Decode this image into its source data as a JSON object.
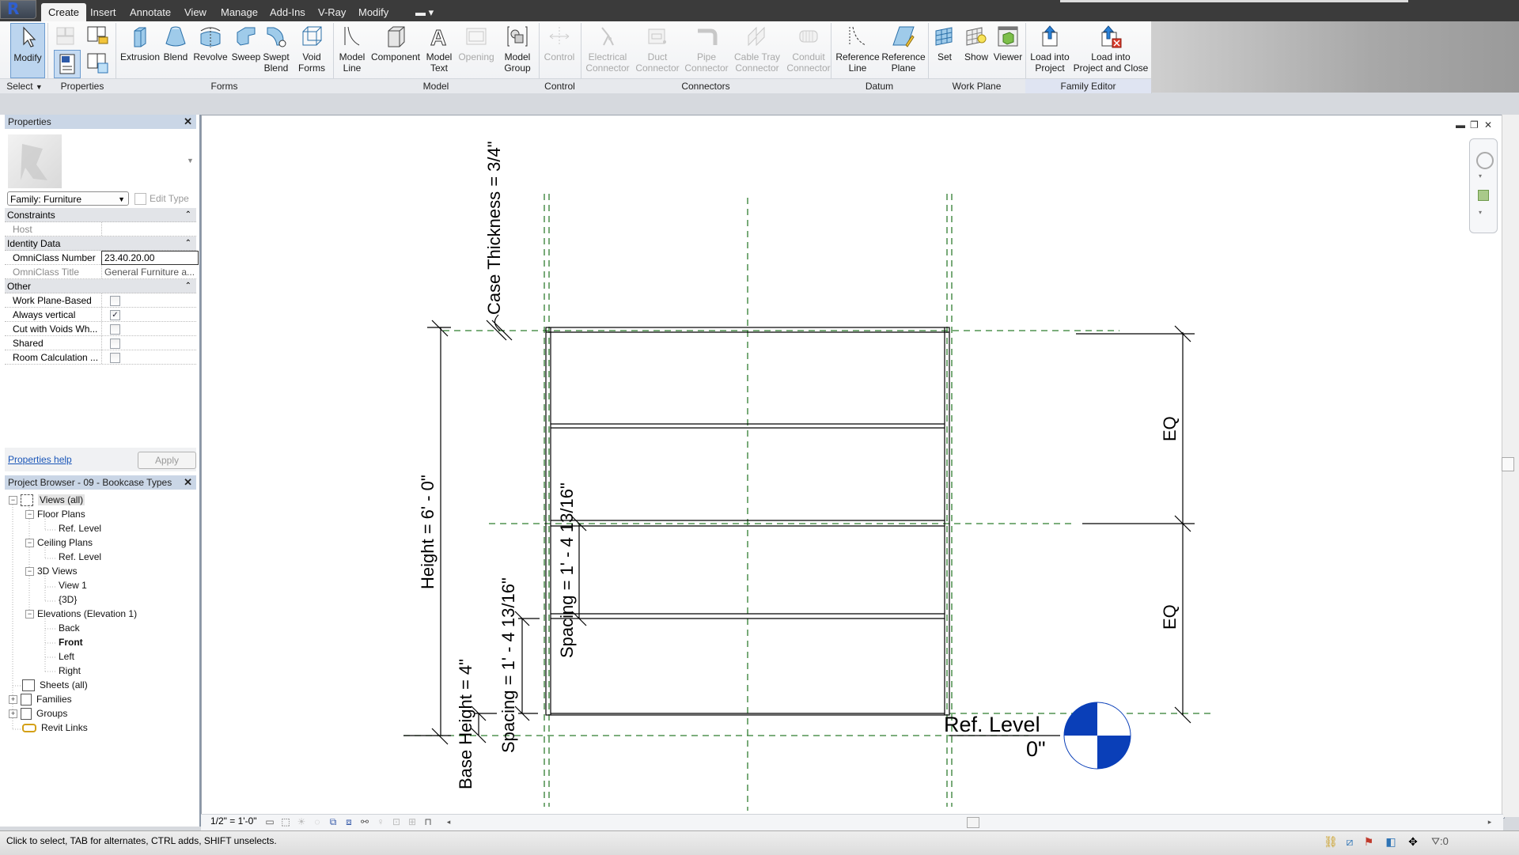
{
  "ribbon": {
    "tabs": [
      "Create",
      "Insert",
      "Annotate",
      "View",
      "Manage",
      "Add-Ins",
      "V-Ray",
      "Modify"
    ],
    "active_tab": "Create",
    "groups": {
      "select": "Select",
      "properties": "Properties",
      "forms": "Forms",
      "model": "Model",
      "control": "Control",
      "connectors": "Connectors",
      "datum": "Datum",
      "work_plane": "Work Plane",
      "family_editor": "Family Editor"
    },
    "buttons": {
      "modify": "Modify",
      "extrusion": "Extrusion",
      "blend": "Blend",
      "revolve": "Revolve",
      "sweep": "Sweep",
      "swept_blend": [
        "Swept",
        "Blend"
      ],
      "void_forms": [
        "Void",
        "Forms"
      ],
      "model_line": [
        "Model",
        "Line"
      ],
      "component": "Component",
      "model_text": [
        "Model",
        "Text"
      ],
      "opening": "Opening",
      "model_group": [
        "Model",
        "Group"
      ],
      "control": "Control",
      "electrical_connector": [
        "Electrical",
        "Connector"
      ],
      "duct_connector": [
        "Duct",
        "Connector"
      ],
      "pipe_connector": [
        "Pipe",
        "Connector"
      ],
      "cable_tray_connector": [
        "Cable Tray",
        "Connector"
      ],
      "conduit_connector": [
        "Conduit",
        "Connector"
      ],
      "reference_line": [
        "Reference",
        "Line"
      ],
      "reference_plane": [
        "Reference",
        "Plane"
      ],
      "set": "Set",
      "show": "Show",
      "viewer": "Viewer",
      "load_into_project": [
        "Load into",
        "Project"
      ],
      "load_into_project_close": [
        "Load into",
        "Project and Close"
      ]
    }
  },
  "properties": {
    "title": "Properties",
    "family_selector": "Family: Furniture",
    "edit_type": "Edit Type",
    "sections": {
      "constraints": "Constraints",
      "identity": "Identity Data",
      "other": "Other"
    },
    "rows": {
      "host": {
        "label": "Host",
        "value": ""
      },
      "omniclass_number": {
        "label": "OmniClass Number",
        "value": "23.40.20.00"
      },
      "omniclass_title": {
        "label": "OmniClass Title",
        "value": "General Furniture a..."
      },
      "work_plane_based": {
        "label": "Work Plane-Based",
        "checked": false
      },
      "always_vertical": {
        "label": "Always vertical",
        "checked": true
      },
      "cut_with_voids": {
        "label": "Cut with Voids Wh...",
        "checked": false
      },
      "shared": {
        "label": "Shared",
        "checked": false
      },
      "room_calculation": {
        "label": "Room Calculation ...",
        "checked": false
      }
    },
    "help_link": "Properties help",
    "apply": "Apply"
  },
  "project_browser": {
    "title": "Project Browser - 09 - Bookcase Types",
    "items": {
      "views_all": "Views (all)",
      "floor_plans": "Floor Plans",
      "floor_ref_level": "Ref. Level",
      "ceiling_plans": "Ceiling Plans",
      "ceiling_ref_level": "Ref. Level",
      "views_3d": "3D Views",
      "view1": "View 1",
      "view3d": "{3D}",
      "elevations": "Elevations (Elevation 1)",
      "back": "Back",
      "front": "Front",
      "left": "Left",
      "right": "Right",
      "sheets": "Sheets (all)",
      "families": "Families",
      "groups": "Groups",
      "revit_links": "Revit Links"
    }
  },
  "drawing": {
    "dimensions": {
      "case_thickness": "Case Thickness = 3/4\"",
      "height": "Height = 6' - 0\"",
      "spacing_upper": "Spacing = 1' - 4 13/16\"",
      "spacing_lower": "Spacing = 1' - 4 13/16\"",
      "base_height": "Base Height = 4\"",
      "eq_top": "EQ",
      "eq_bottom": "EQ"
    },
    "level": {
      "name": "Ref. Level",
      "elevation": "0\""
    },
    "colors": {
      "ref_plane": "#2f7d2f",
      "level_marker": "#0a3fb8"
    }
  },
  "view_control": {
    "scale": "1/2\" = 1'-0\""
  },
  "status": {
    "message": "Click to select, TAB for alternates, CTRL adds, SHIFT unselects.",
    "filter_count": ":0"
  }
}
